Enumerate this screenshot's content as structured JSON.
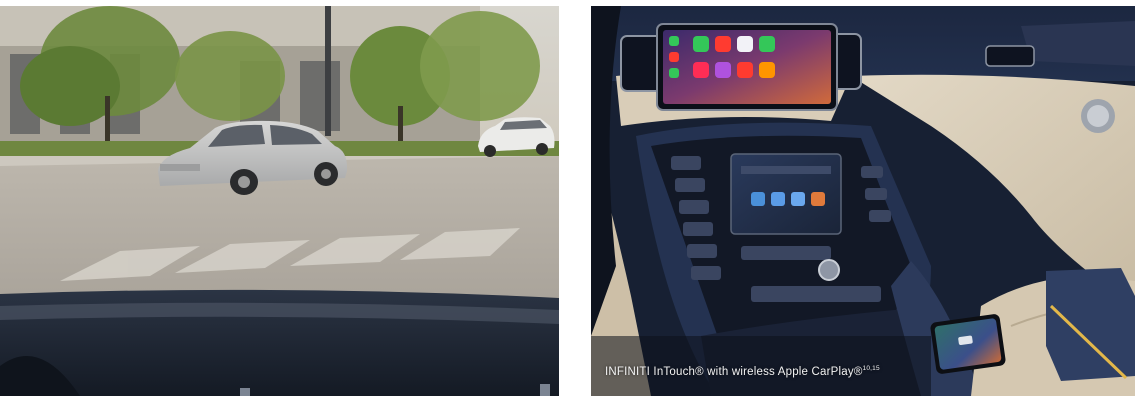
{
  "photos": {
    "left": {
      "subject": "road-through-windshield"
    },
    "right": {
      "subject": "infiniti-dashboard",
      "caption_main": "INFINITI InTouch® with wireless Apple CarPlay®",
      "caption_sup": "10,15"
    }
  },
  "colors": {
    "carplay_green": "#34c759",
    "carplay_red": "#ff3b30",
    "dash_navy": "#1b2a44",
    "cream_leather": "#d9cdb8"
  }
}
